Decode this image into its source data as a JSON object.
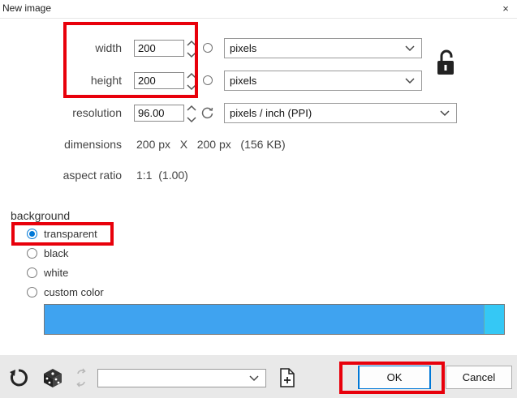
{
  "window": {
    "title": "New image",
    "close_glyph": "×"
  },
  "size": {
    "width": {
      "label": "width",
      "value": "200",
      "unit": "pixels"
    },
    "height": {
      "label": "height",
      "value": "200",
      "unit": "pixels"
    },
    "resolution": {
      "label": "resolution",
      "value": "96.00",
      "unit": "pixels / inch (PPI)"
    },
    "lock_icon": "unlocked-padlock-icon"
  },
  "info": {
    "dimensions_label": "dimensions",
    "dimensions_value": "200 px   X   200 px   (156 KB)",
    "aspect_label": "aspect ratio",
    "aspect_value": "1:1  (1.00)"
  },
  "background": {
    "heading": "background",
    "options": [
      {
        "label": "transparent",
        "selected": true
      },
      {
        "label": "black",
        "selected": false
      },
      {
        "label": "white",
        "selected": false
      },
      {
        "label": "custom color",
        "selected": false
      }
    ],
    "swatch_color": "#3fa3f0",
    "swatch_edge_color": "#35c8f5"
  },
  "footer": {
    "preset_value": "",
    "ok_label": "OK",
    "cancel_label": "Cancel"
  },
  "colors": {
    "highlight": "#e8000b",
    "accent": "#0078d7"
  }
}
